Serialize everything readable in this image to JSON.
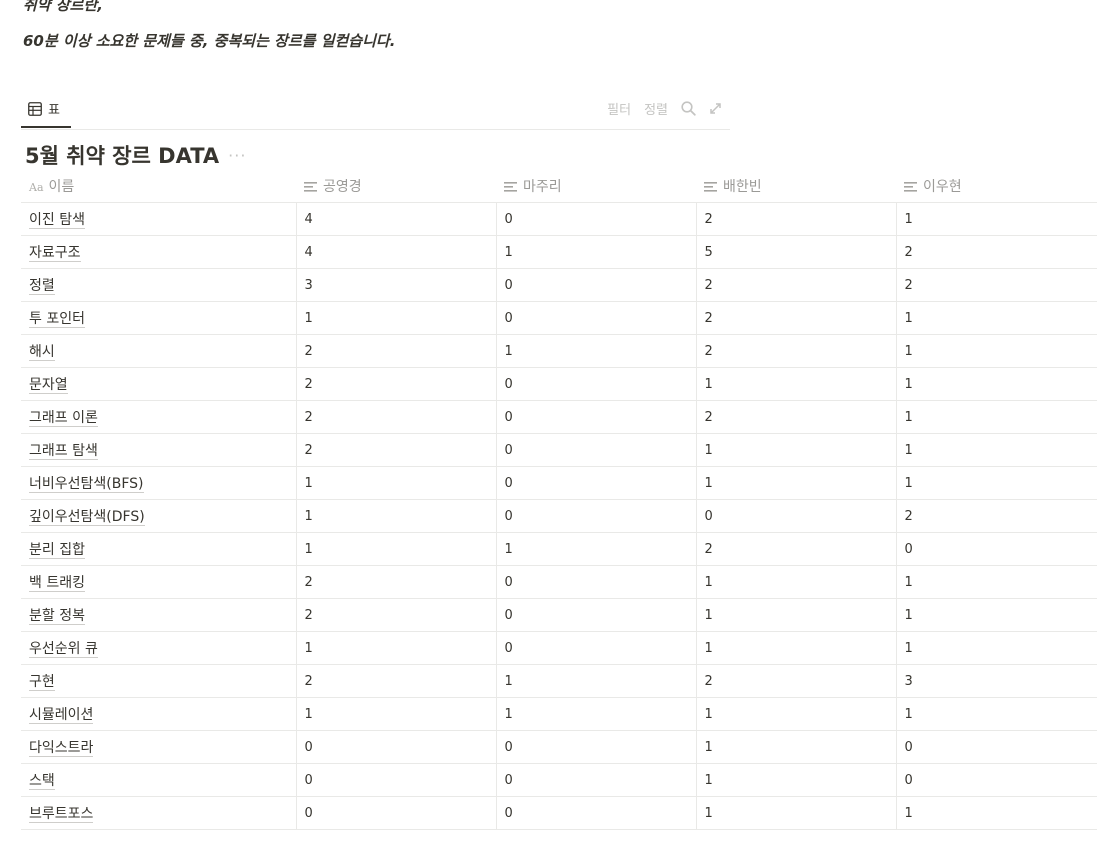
{
  "intro": {
    "line1": "취약 장르란,",
    "line2": "60분 이상 소요한 문제들 중, 중복되는 장르를 일컫습니다."
  },
  "view": {
    "tab_label": "표",
    "filter_label": "필터",
    "sort_label": "정렬"
  },
  "database": {
    "title": "5월 취약 장르 DATA",
    "more": "···"
  },
  "table": {
    "name_icon": "Aa",
    "columns": [
      "이름",
      "공영경",
      "마주리",
      "배한빈",
      "이우현"
    ],
    "rows": [
      {
        "name": "이진 탐색",
        "v": [
          "4",
          "0",
          "2",
          "1"
        ]
      },
      {
        "name": "자료구조",
        "v": [
          "4",
          "1",
          "5",
          "2"
        ]
      },
      {
        "name": "정렬",
        "v": [
          "3",
          "0",
          "2",
          "2"
        ]
      },
      {
        "name": "투 포인터",
        "v": [
          "1",
          "0",
          "2",
          "1"
        ]
      },
      {
        "name": "해시",
        "v": [
          "2",
          "1",
          "2",
          "1"
        ]
      },
      {
        "name": "문자열",
        "v": [
          "2",
          "0",
          "1",
          "1"
        ]
      },
      {
        "name": "그래프 이론",
        "v": [
          "2",
          "0",
          "2",
          "1"
        ]
      },
      {
        "name": "그래프 탐색",
        "v": [
          "2",
          "0",
          "1",
          "1"
        ]
      },
      {
        "name": "너비우선탐색(BFS)",
        "v": [
          "1",
          "0",
          "1",
          "1"
        ]
      },
      {
        "name": "깊이우선탐색(DFS)",
        "v": [
          "1",
          "0",
          "0",
          "2"
        ]
      },
      {
        "name": "분리 집합",
        "v": [
          "1",
          "1",
          "2",
          "0"
        ]
      },
      {
        "name": "백 트래킹",
        "v": [
          "2",
          "0",
          "1",
          "1"
        ]
      },
      {
        "name": "분할 정복",
        "v": [
          "2",
          "0",
          "1",
          "1"
        ]
      },
      {
        "name": "우선순위 큐",
        "v": [
          "1",
          "0",
          "1",
          "1"
        ]
      },
      {
        "name": "구현",
        "v": [
          "2",
          "1",
          "2",
          "3"
        ]
      },
      {
        "name": "시뮬레이션",
        "v": [
          "1",
          "1",
          "1",
          "1"
        ]
      },
      {
        "name": "다익스트라",
        "v": [
          "0",
          "0",
          "1",
          "0"
        ]
      },
      {
        "name": "스택",
        "v": [
          "0",
          "0",
          "1",
          "0"
        ]
      },
      {
        "name": "브루트포스",
        "v": [
          "0",
          "0",
          "1",
          "1"
        ]
      }
    ]
  }
}
